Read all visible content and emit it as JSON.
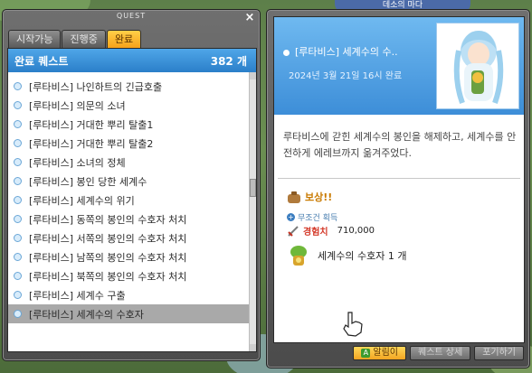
{
  "left_window": {
    "title": "QUEST",
    "close": "×",
    "tabs": [
      "시작가능",
      "진행중",
      "완료"
    ],
    "active_tab": 2,
    "list_header": {
      "label": "완료 퀘스트",
      "count": "382 개"
    },
    "quests": [
      "[루타비스] 나인하트의 긴급호출",
      "[루타비스] 의문의 소녀",
      "[루타비스] 거대한 뿌리 탈출1",
      "[루타비스] 거대한 뿌리 탈출2",
      "[루타비스] 소녀의 정체",
      "[루타비스] 봉인 당한 세계수",
      "[루타비스] 세계수의 위기",
      "[루타비스] 동쪽의 봉인의 수호자 처치",
      "[루타비스] 서쪽의 봉인의 수호자 처치",
      "[루타비스] 남쪽의 봉인의 수호자 처치",
      "[루타비스] 북쪽의 봉인의 수호자 처치",
      "[루타비스] 세계수 구출",
      "[루타비스] 세계수의 수호자"
    ],
    "selected_index": 12
  },
  "right_window": {
    "title": "[루타비스] 세계수의 수..",
    "date": "2024년 3월 21일 16시 완료",
    "description": "루타비스에 갇힌 세계수의 봉인을 해제하고, 세계수를 안전하게 에레브까지 옮겨주었다.",
    "reward_label": "보상!!",
    "reward_sub": "무조건 획득",
    "exp_label": "경험치",
    "exp_value": "710,000",
    "item_text": "세계수의 수호자 1 개",
    "buttons": {
      "primary_key": "A",
      "primary": "알림이",
      "second": "퀘스트 상세",
      "third": "포기하기"
    }
  },
  "top_banner": "데소의 마다"
}
